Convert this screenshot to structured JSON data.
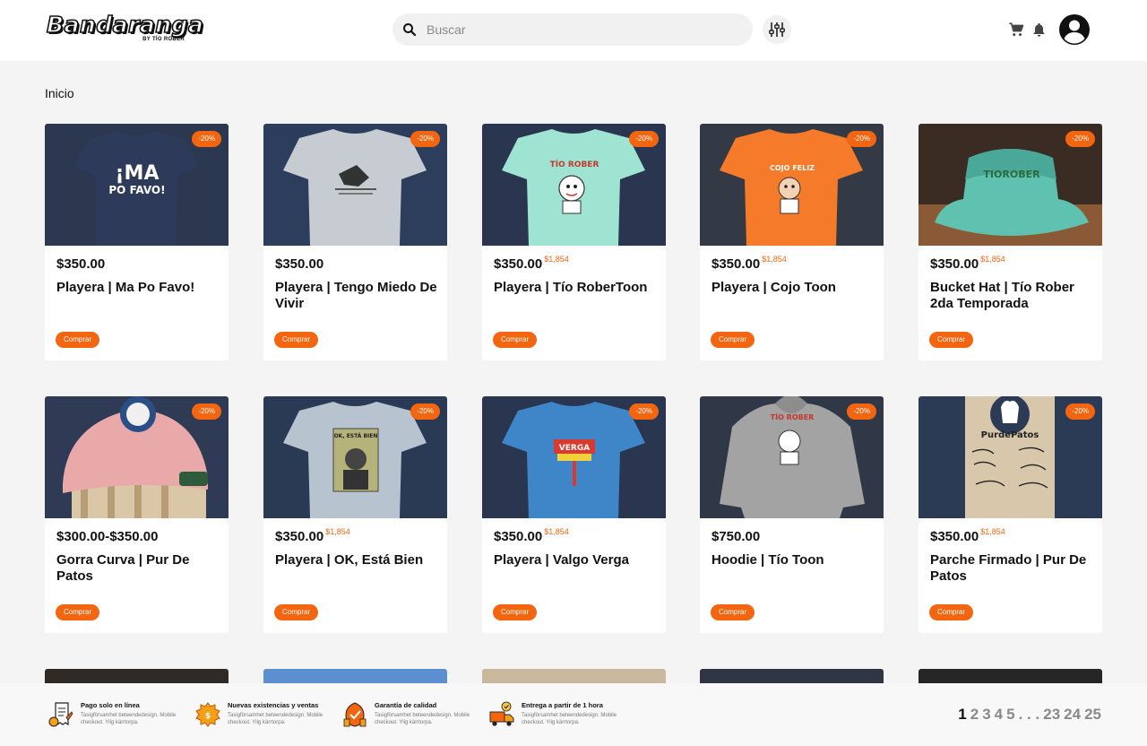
{
  "brand": {
    "name": "Bandaranga",
    "byline": "BY TÍO ROBER"
  },
  "search": {
    "placeholder": "Buscar"
  },
  "breadcrumb": "Inicio",
  "colors": {
    "accent": "#f4650f"
  },
  "products": [
    {
      "price": "$350.00",
      "old_price": "",
      "title": "Playera | Ma Po Favo!",
      "discount": "-20%",
      "button": "Comprar"
    },
    {
      "price": "$350.00",
      "old_price": "",
      "title": "Playera | Tengo Miedo De Vivir",
      "discount": "-20%",
      "button": "Comprar"
    },
    {
      "price": "$350.00",
      "old_price": "$1,854",
      "title": "Playera | Tío RoberToon",
      "discount": "-20%",
      "button": "Comprar"
    },
    {
      "price": "$350.00",
      "old_price": "$1,854",
      "title": "Playera | Cojo Toon",
      "discount": "-20%",
      "button": "Comprar"
    },
    {
      "price": "$350.00",
      "old_price": "$1,854",
      "title": "Bucket Hat | Tío Rober 2da Temporada",
      "discount": "-20%",
      "button": "Comprar"
    },
    {
      "price": "$300.00-$350.00",
      "old_price": "",
      "title": "Gorra Curva | Pur De Patos",
      "discount": "-20%",
      "button": "Comprar"
    },
    {
      "price": "$350.00",
      "old_price": "$1,854",
      "title": "Playera | OK, Está Bien",
      "discount": "-20%",
      "button": "Comprar"
    },
    {
      "price": "$350.00",
      "old_price": "$1,854",
      "title": "Playera | Valgo Verga",
      "discount": "-20%",
      "button": "Comprar"
    },
    {
      "price": "$750.00",
      "old_price": "",
      "title": "Hoodie | Tío Toon",
      "discount": "-20%",
      "button": "Comprar"
    },
    {
      "price": "$350.00",
      "old_price": "$1,854",
      "title": "Parche Firmado | Pur De Patos",
      "discount": "-20%",
      "button": "Comprar"
    }
  ],
  "features": [
    {
      "title": "Pago solo en línea",
      "desc": "Tasigförsamhet beteendedesign. Mobile checkout. Ylig kärrtorpa.",
      "icon": "receipt-icon"
    },
    {
      "title": "Nuevas existencias y ventas",
      "desc": "Tasigförsamhet beteendedesign. Mobile checkout. Ylig kärrtorpa.",
      "icon": "sale-tag-icon"
    },
    {
      "title": "Garantía de calidad",
      "desc": "Tasigförsamhet beteendedesign. Mobile checkout. Ylig kärrtorpa.",
      "icon": "quality-icon"
    },
    {
      "title": "Entrega a partir de 1 hora",
      "desc": "Tasigförsamhet beteendedesign. Mobile checkout. Ylig kärrtorpa.",
      "icon": "delivery-truck-icon"
    }
  ],
  "pagination": {
    "current": "1",
    "pages": [
      "1",
      "2",
      "3",
      "4",
      "5",
      ". . .",
      "23",
      "24",
      "25"
    ]
  }
}
